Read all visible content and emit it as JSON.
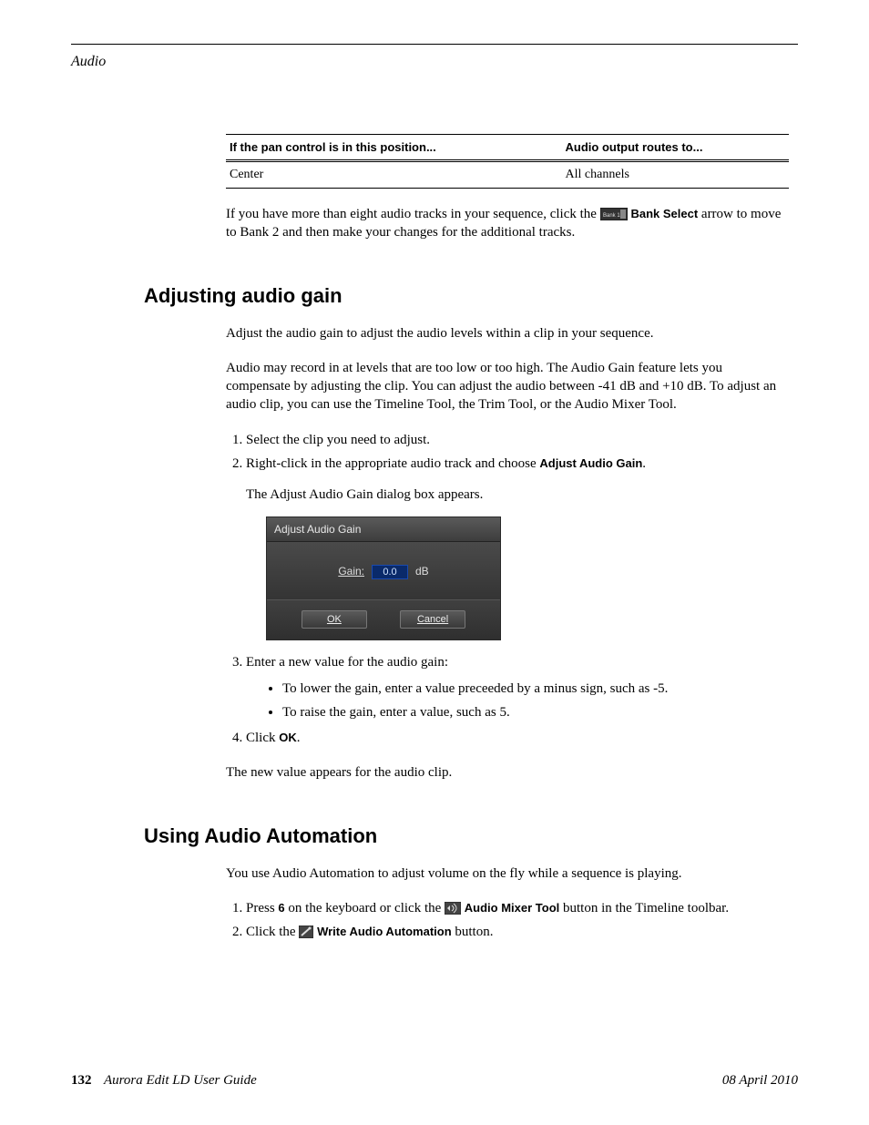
{
  "running_head": "Audio",
  "table": {
    "col1_header": "If the pan control is in this position...",
    "col2_header": "Audio output routes to...",
    "row1_col1": "Center",
    "row1_col2": "All channels"
  },
  "intro_para": {
    "pre": "If you have more than eight audio tracks in your sequence, click the ",
    "bank_select_label": "Bank Select",
    "post": " arrow to move to Bank 2 and then make your changes for the additional tracks."
  },
  "section_gain": {
    "heading": "Adjusting audio gain",
    "p1": "Adjust the audio gain to adjust the audio levels within a clip in your sequence.",
    "p2": "Audio may record in at levels that are too low or too high. The Audio Gain feature lets you compensate by adjusting the clip. You can adjust the audio between -41 dB and +10 dB. To adjust an audio clip, you can use the Timeline Tool, the Trim Tool, or the Audio Mixer Tool.",
    "step1": "Select the clip you need to adjust.",
    "step2_pre": "Right-click in the appropriate audio track and choose ",
    "step2_cmd": "Adjust Audio Gain",
    "step2_post": ".",
    "step2_result": "The Adjust Audio Gain dialog box appears.",
    "dialog": {
      "title": "Adjust Audio Gain",
      "gain_label": "Gain:",
      "gain_value": "0.0",
      "gain_unit": "dB",
      "ok": "OK",
      "cancel": "Cancel"
    },
    "step3": "Enter a new value for the audio gain:",
    "step3_b1": "To lower the gain, enter a value preceeded by a minus sign, such as -5.",
    "step3_b2": "To raise the gain, enter a value, such as 5.",
    "step4_pre": "Click ",
    "step4_cmd": "OK",
    "step4_post": ".",
    "closing": "The new value appears for the audio clip."
  },
  "section_auto": {
    "heading": "Using Audio Automation",
    "p1": "You use Audio Automation to adjust volume on the fly while a sequence is playing.",
    "step1_pre": "Press ",
    "step1_key": "6",
    "step1_mid": " on the keyboard or click the ",
    "step1_btn": "Audio Mixer Tool",
    "step1_post": " button in the Timeline toolbar.",
    "step2_pre": "Click the ",
    "step2_btn": "Write Audio Automation",
    "step2_post": " button."
  },
  "footer": {
    "page": "132",
    "book": "Aurora Edit LD User Guide",
    "date": "08 April 2010"
  }
}
